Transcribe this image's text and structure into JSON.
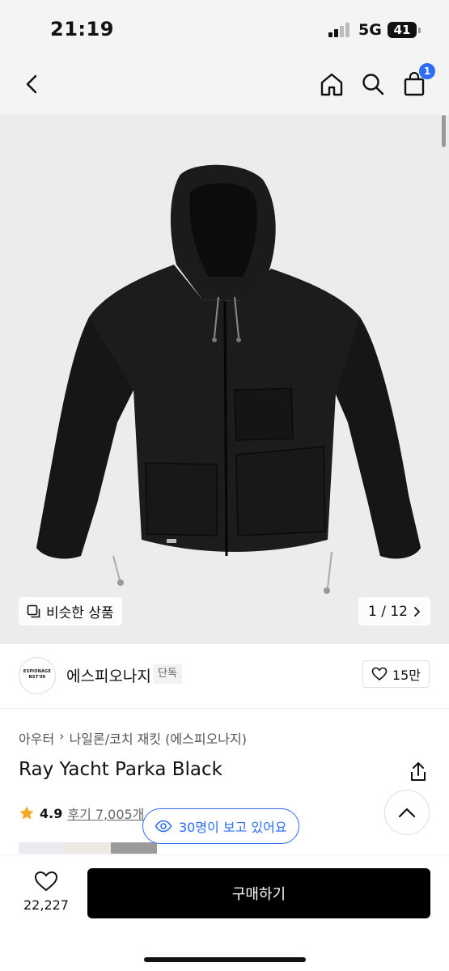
{
  "status_bar": {
    "time": "21:19",
    "network": "5G",
    "battery": "41"
  },
  "header": {
    "back_icon": "chevron-left-icon",
    "home_icon": "home-icon",
    "search_icon": "search-icon",
    "cart_icon": "shopping-bag-icon",
    "cart_count": "1"
  },
  "gallery": {
    "similar_label": "비슷한 상품",
    "page_current": "1",
    "page_total": "12",
    "page_text": "1 / 12"
  },
  "brand": {
    "logo_text": "ESPIONAGE",
    "logo_sub": "NST'06",
    "name": "에스피오나지",
    "badge": "단독",
    "like_count": "15만"
  },
  "product": {
    "breadcrumb": [
      "아우터",
      "나일론/코치 재킷 (에스피오나지)"
    ],
    "title": "Ray Yacht Parka Black",
    "rating": "4.9",
    "reviews": "후기 7,005개",
    "viewers": "30명이 보고 있어요"
  },
  "bottom_bar": {
    "like_count": "22,227",
    "buy_label": "구매하기"
  },
  "colors": {
    "accent": "#2d6cf6",
    "star": "#f5a623",
    "buy_button": "#000000"
  }
}
